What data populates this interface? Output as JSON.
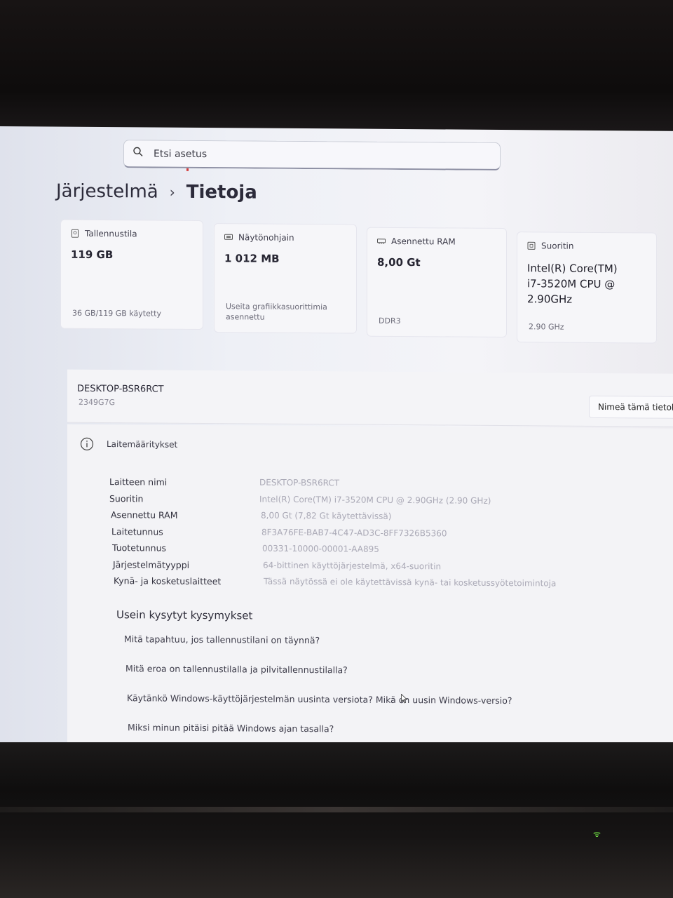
{
  "search": {
    "placeholder": "Etsi asetus"
  },
  "breadcrumb": {
    "parent": "Järjestelmä",
    "separator": "›",
    "current": "Tietoja"
  },
  "cards": [
    {
      "icon": "storage-icon",
      "label": "Tallennustila",
      "value": "119 GB",
      "footer": "36 GB/119 GB käytetty",
      "used_fraction": 0.3
    },
    {
      "icon": "display-adapter-icon",
      "label": "Näytönohjain",
      "value": "1 012 MB",
      "footer": "Useita grafiikkasuorittimia asennettu"
    },
    {
      "icon": "ram-icon",
      "label": "Asennettu RAM",
      "value": "8,00 Gt",
      "footer": "DDR3"
    },
    {
      "icon": "processor-icon",
      "label": "Suoritin",
      "value": "Intel(R) Core(TM) i7-3520M CPU @ 2.90GHz",
      "footer": "2.90 GHz"
    }
  ],
  "device": {
    "name": "DESKTOP-BSR6RCT",
    "model": "2349G7G",
    "rename_label": "Nimeä tämä tietok"
  },
  "specs": {
    "title": "Laitemääritykset",
    "rows": [
      {
        "label": "Laitteen nimi",
        "value": "DESKTOP-BSR6RCT"
      },
      {
        "label": "Suoritin",
        "value": "Intel(R) Core(TM) i7-3520M CPU @ 2.90GHz (2.90 GHz)"
      },
      {
        "label": "Asennettu RAM",
        "value": "8,00 Gt (7,82 Gt käytettävissä)"
      },
      {
        "label": "Laitetunnus",
        "value": "8F3A76FE-BAB7-4C47-AD3C-8FF7326B5360"
      },
      {
        "label": "Tuotetunnus",
        "value": "00331-10000-00001-AA895"
      },
      {
        "label": "Järjestelmätyyppi",
        "value": "64-bittinen käyttöjärjestelmä, x64-suoritin"
      },
      {
        "label": "Kynä- ja kosketuslaitteet",
        "value": "Tässä näytössä ei ole käytettävissä kynä- tai kosketussyötetoimintoja"
      }
    ]
  },
  "faq": {
    "title": "Usein kysytyt kysymykset",
    "items": [
      "Mitä tapahtuu, jos tallennustilani on täynnä?",
      "Mitä eroa on tallennustilalla ja pilvitallennustilalla?",
      "Käytänkö Windows-käyttöjärjestelmän uusinta versiota? Mikä on uusin Windows-versio?",
      "Miksi minun pitäisi pitää Windows ajan tasalla?"
    ]
  },
  "colors": {
    "screen_bg": "#eef0f6",
    "text_primary": "#2c2b3a",
    "text_dim": "#aaa9b6",
    "wifi_led": "#7dff4a"
  }
}
